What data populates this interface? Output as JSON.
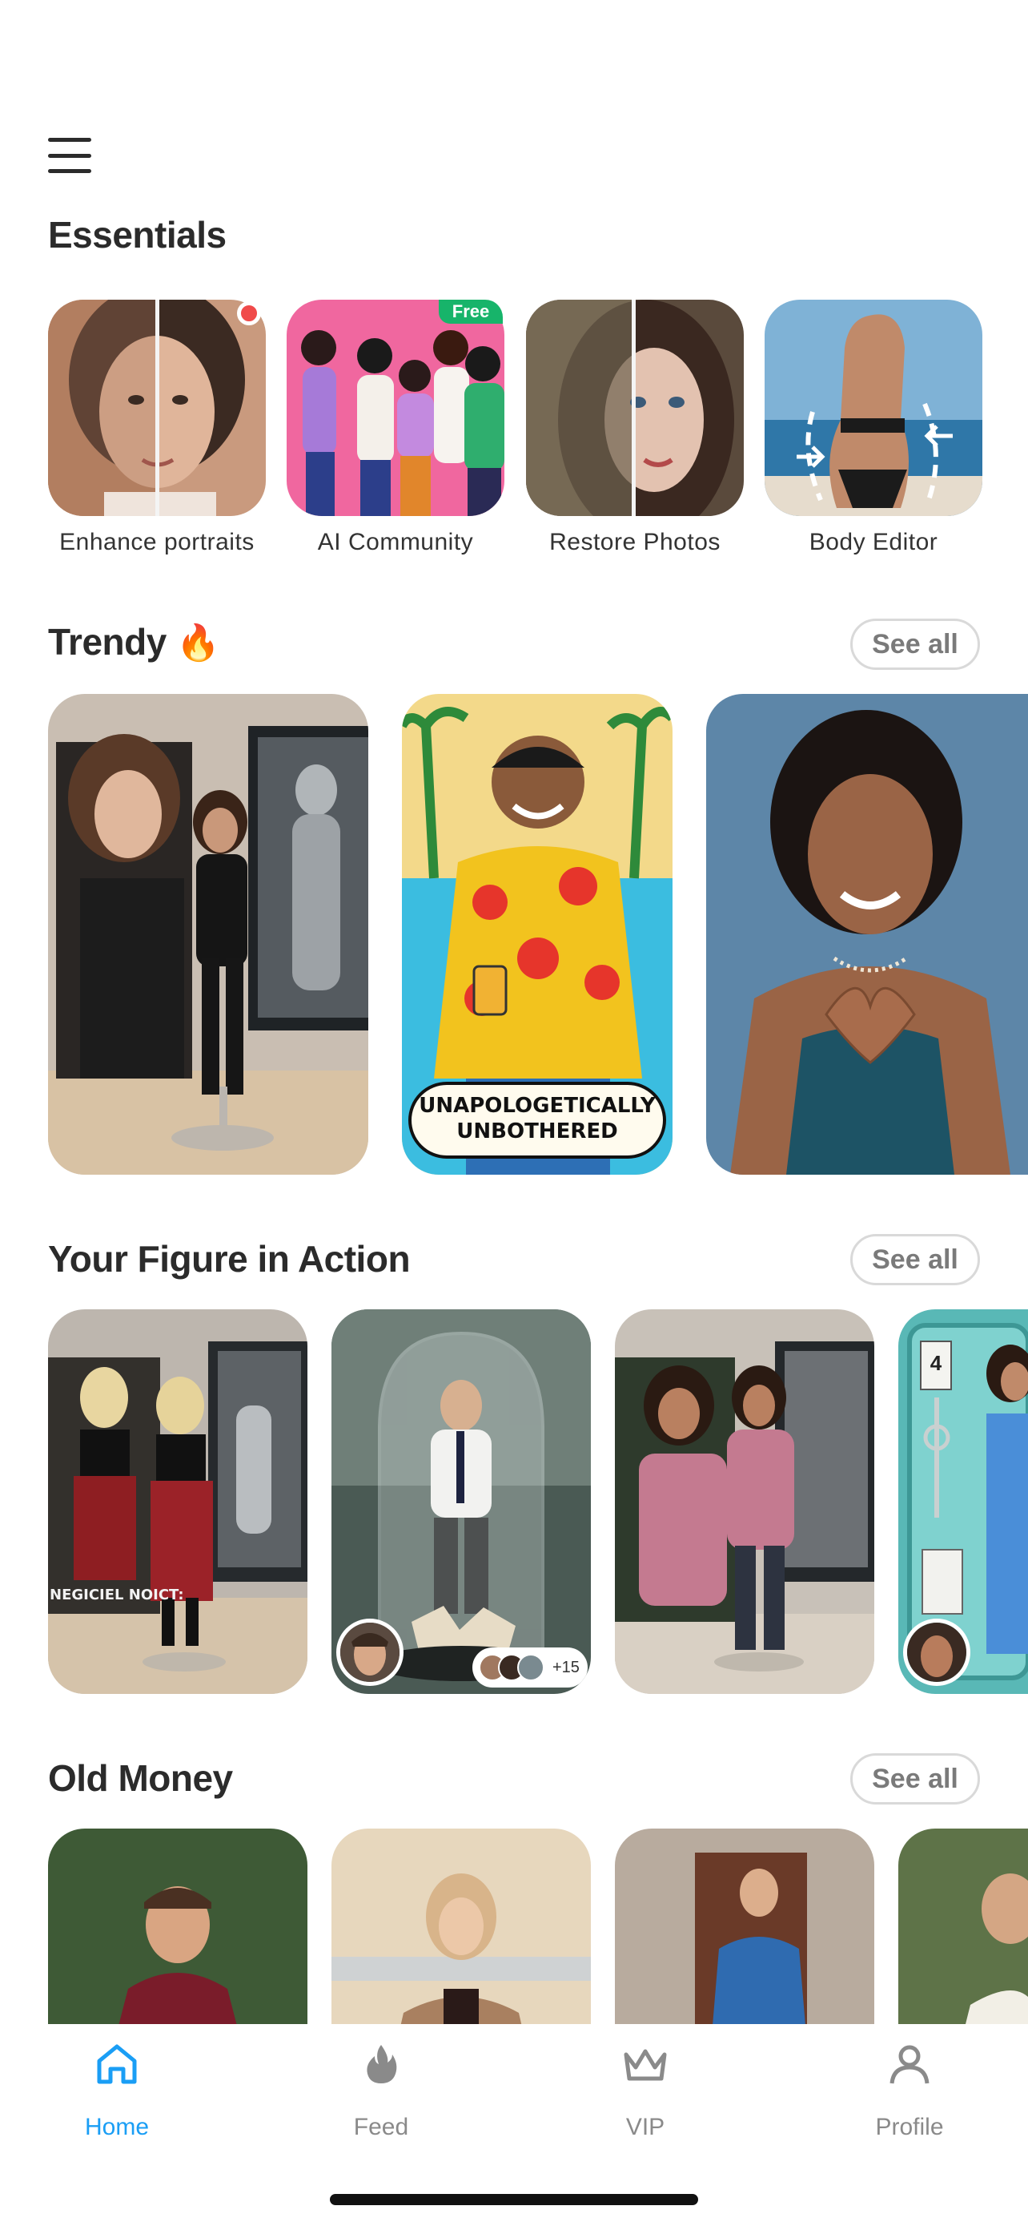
{
  "essentials": {
    "title": "Essentials",
    "items": [
      {
        "label": "Enhance portraits"
      },
      {
        "label": "AI Community",
        "badge": "Free"
      },
      {
        "label": "Restore Photos"
      },
      {
        "label": "Body Editor"
      }
    ]
  },
  "trendy": {
    "title": "Trendy",
    "emoji": "🔥",
    "see_all": "See all",
    "cards": [
      {
        "name": "figure-desk-photo"
      },
      {
        "name": "pop-art-beach",
        "caption": "UNAPOLOGETICALLY\nUNBOTHERED"
      },
      {
        "name": "heart-hands-portrait"
      }
    ]
  },
  "figure_in_action": {
    "title": "Your Figure in Action",
    "see_all": "See all",
    "cards": [
      {
        "name": "plaid-skirt-figure",
        "sign_text": "NEGICIEL NOICT:"
      },
      {
        "name": "glass-dome-figure",
        "extra_count": "+15"
      },
      {
        "name": "pink-sweater-figure"
      },
      {
        "name": "doll-box-figure",
        "box_number": "4"
      }
    ]
  },
  "old_money": {
    "title": "Old Money",
    "see_all": "See all",
    "cards": [
      {
        "name": "red-blazer-man"
      },
      {
        "name": "jet-woman"
      },
      {
        "name": "blue-sweater-man"
      },
      {
        "name": "garden-man"
      }
    ]
  },
  "bottom_nav": {
    "items": [
      {
        "label": "Home",
        "icon": "home-icon",
        "active": true
      },
      {
        "label": "Feed",
        "icon": "flame-icon",
        "active": false
      },
      {
        "label": "VIP",
        "icon": "crown-icon",
        "active": false
      },
      {
        "label": "Profile",
        "icon": "person-icon",
        "active": false
      }
    ],
    "active_color": "#1a9ef5",
    "inactive_color": "#8a8a8a"
  }
}
